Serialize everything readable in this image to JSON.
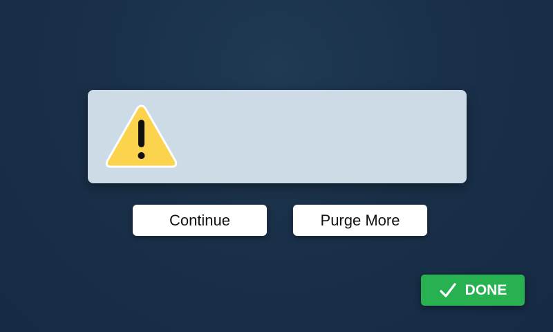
{
  "dialog": {
    "icon": "warning-icon",
    "icon_color": "#fcd34d"
  },
  "buttons": {
    "continue_label": "Continue",
    "purge_more_label": "Purge More",
    "done_label": "DONE",
    "done_icon": "check-icon",
    "done_color": "#27b150"
  }
}
